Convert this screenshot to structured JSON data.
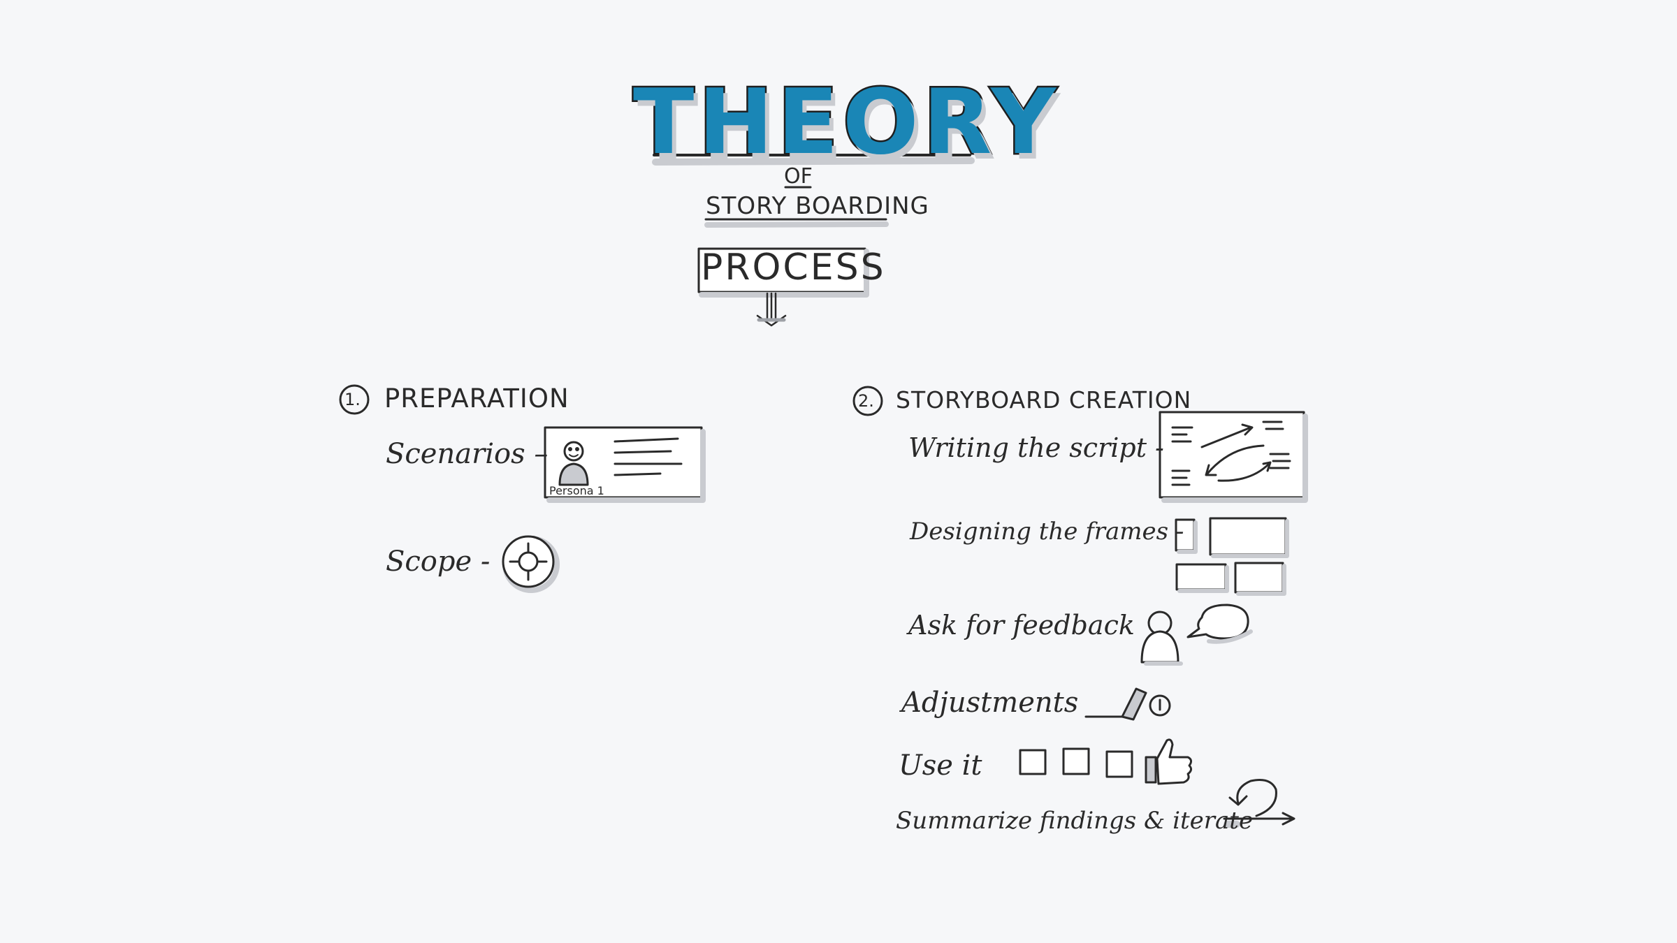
{
  "title": {
    "main": "THEORY",
    "of": "OF",
    "sub": "STORY BOARDING",
    "process": "PROCESS"
  },
  "sections": [
    {
      "number": "1.",
      "title": "PREPARATION",
      "items": [
        {
          "label": "Scenarios –",
          "icon": "scenario-card-icon",
          "sublabel": "Persona 1"
        },
        {
          "label": "Scope -",
          "icon": "target-icon"
        }
      ]
    },
    {
      "number": "2.",
      "title": "STORYBOARD CREATION",
      "items": [
        {
          "label": "Writing the script -",
          "icon": "script-board-icon"
        },
        {
          "label": "Designing the frames -",
          "icon": "frames-icon"
        },
        {
          "label": "Ask for feedback",
          "icon": "person-speech-icon"
        },
        {
          "label": "Adjustments",
          "icon": "pencil-icon"
        },
        {
          "label": "Use it",
          "icon": "thumbs-up-icon"
        },
        {
          "label": "Summarize findings & iterate",
          "icon": "loop-arrow-icon"
        }
      ]
    }
  ],
  "colors": {
    "accent": "#1a86b6",
    "ink": "#2a2a2a",
    "shadow": "#c9cbd0",
    "paper": "#f6f7f9"
  }
}
